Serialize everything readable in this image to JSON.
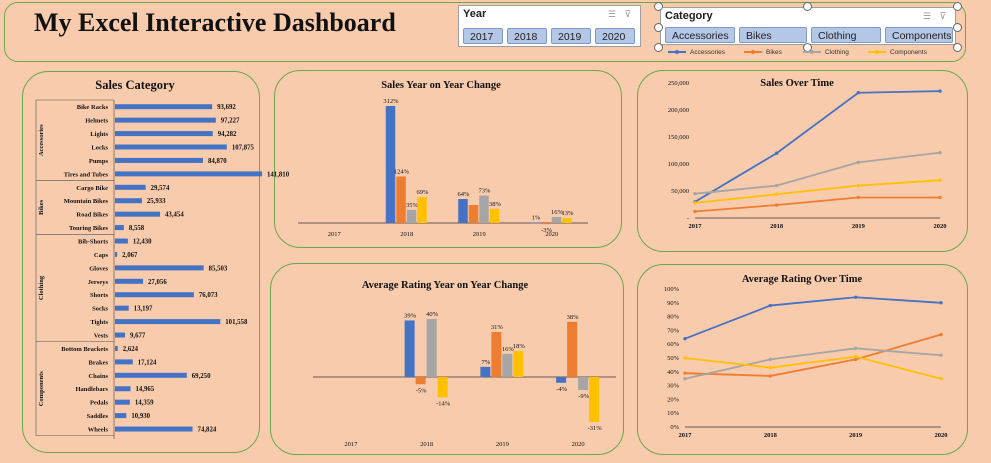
{
  "header": {
    "title": "My Excel Interactive Dashboard"
  },
  "year_slicer": {
    "title": "Year",
    "items": [
      "2017",
      "2018",
      "2019",
      "2020"
    ]
  },
  "category_slicer": {
    "title": "Category",
    "items": [
      "Accessories",
      "Bikes",
      "Clothing",
      "Components"
    ],
    "legend": [
      "Accessories",
      "Bikes",
      "Clothing",
      "Components"
    ]
  },
  "colors": {
    "accessories": "#4472c4",
    "bikes": "#ed7d31",
    "clothing": "#a5a5a5",
    "components": "#ffc000",
    "panel_border": "#6aa84f",
    "background": "#f8cbad"
  },
  "chart_data": [
    {
      "id": "sales_category",
      "type": "bar",
      "orientation": "horizontal",
      "title": "Sales Category",
      "groups": [
        {
          "name": "Accessories",
          "categories": [
            "Bike Racks",
            "Helmets",
            "Lights",
            "Locks",
            "Pumps",
            "Tires and Tubes"
          ],
          "values": [
            93692,
            97227,
            94282,
            107875,
            84870,
            141810
          ],
          "labels": [
            "93,692",
            "97,227",
            "94,282",
            "107,875",
            "84,870",
            "141,810"
          ]
        },
        {
          "name": "Bikes",
          "categories": [
            "Cargo Bike",
            "Mountain Bikes",
            "Road Bikes",
            "Touring Bikes"
          ],
          "values": [
            29574,
            25933,
            43454,
            8558
          ],
          "labels": [
            "29,574",
            "25,933",
            "43,454",
            "8,558"
          ]
        },
        {
          "name": "Clothing",
          "categories": [
            "Bib-Shorts",
            "Caps",
            "Gloves",
            "Jerseys",
            "Shorts",
            "Socks",
            "Tights",
            "Vests"
          ],
          "values": [
            12430,
            2067,
            85503,
            27056,
            76073,
            13197,
            101558,
            9677
          ],
          "labels": [
            "12,430",
            "2,067",
            "85,503",
            "27,056",
            "76,073",
            "13,197",
            "101,558",
            "9,677"
          ]
        },
        {
          "name": "Components",
          "categories": [
            "Bottom Brackets",
            "Brakes",
            "Chains",
            "Handlebars",
            "Pedals",
            "Saddles",
            "Wheels"
          ],
          "values": [
            2624,
            17124,
            69250,
            14965,
            14359,
            10930,
            74824
          ],
          "labels": [
            "2,624",
            "17,124",
            "69,250",
            "14,965",
            "14,359",
            "10,930",
            "74,824"
          ]
        }
      ]
    },
    {
      "id": "sales_yoy",
      "type": "bar",
      "title": "Sales Year on Year Change",
      "categories": [
        "2017",
        "2018",
        "2019",
        "2020"
      ],
      "series": [
        {
          "name": "Accessories",
          "values": [
            null,
            312,
            64,
            1
          ],
          "labels": [
            "",
            "312%",
            "64%",
            "1%"
          ]
        },
        {
          "name": "Bikes",
          "values": [
            null,
            124,
            48,
            -3
          ],
          "labels": [
            "",
            "124%",
            "",
            "-3%"
          ]
        },
        {
          "name": "Clothing",
          "values": [
            null,
            35,
            73,
            16
          ],
          "labels": [
            "",
            "35%",
            "73%",
            "16%"
          ]
        },
        {
          "name": "Components",
          "values": [
            null,
            69,
            38,
            13
          ],
          "labels": [
            "",
            "69%",
            "38%",
            "13%"
          ]
        }
      ]
    },
    {
      "id": "sales_over_time",
      "type": "line",
      "title": "Sales Over Time",
      "x": [
        "2017",
        "2018",
        "2019",
        "2020"
      ],
      "ylim": [
        0,
        250000
      ],
      "yticks": [
        "-",
        "50,000",
        "100,000",
        "150,000",
        "200,000",
        "250,000"
      ],
      "series": [
        {
          "name": "Accessories",
          "values": [
            30000,
            120000,
            232000,
            235000
          ]
        },
        {
          "name": "Bikes",
          "values": [
            12000,
            24000,
            38000,
            38000
          ]
        },
        {
          "name": "Clothing",
          "values": [
            45000,
            60000,
            103000,
            121000
          ]
        },
        {
          "name": "Components",
          "values": [
            28000,
            44000,
            60000,
            70000
          ]
        }
      ]
    },
    {
      "id": "rating_yoy",
      "type": "bar",
      "title": "Average Rating Year on Year Change",
      "categories": [
        "2017",
        "2018",
        "2019",
        "2020"
      ],
      "series": [
        {
          "name": "Accessories",
          "values": [
            null,
            39,
            7,
            -4
          ],
          "labels": [
            "",
            "39%",
            "7%",
            "-4%"
          ]
        },
        {
          "name": "Bikes",
          "values": [
            null,
            -5,
            31,
            38
          ],
          "labels": [
            "",
            "-5%",
            "31%",
            "38%"
          ]
        },
        {
          "name": "Clothing",
          "values": [
            null,
            40,
            16,
            -9
          ],
          "labels": [
            "",
            "40%",
            "16%",
            "-9%"
          ]
        },
        {
          "name": "Components",
          "values": [
            null,
            -14,
            18,
            -31
          ],
          "labels": [
            "",
            "-14%",
            "18%",
            "-31%"
          ]
        }
      ]
    },
    {
      "id": "rating_over_time",
      "type": "line",
      "title": "Average Rating Over Time",
      "x": [
        "2017",
        "2018",
        "2019",
        "2020"
      ],
      "ylim": [
        0,
        100
      ],
      "yticks": [
        "0%",
        "10%",
        "20%",
        "30%",
        "40%",
        "50%",
        "60%",
        "70%",
        "80%",
        "90%",
        "100%"
      ],
      "series": [
        {
          "name": "Accessories",
          "values": [
            64,
            88,
            94,
            90
          ]
        },
        {
          "name": "Bikes",
          "values": [
            39,
            37,
            49,
            67
          ]
        },
        {
          "name": "Clothing",
          "values": [
            35,
            49,
            57,
            52
          ]
        },
        {
          "name": "Components",
          "values": [
            50,
            43,
            51,
            35
          ]
        }
      ]
    }
  ]
}
